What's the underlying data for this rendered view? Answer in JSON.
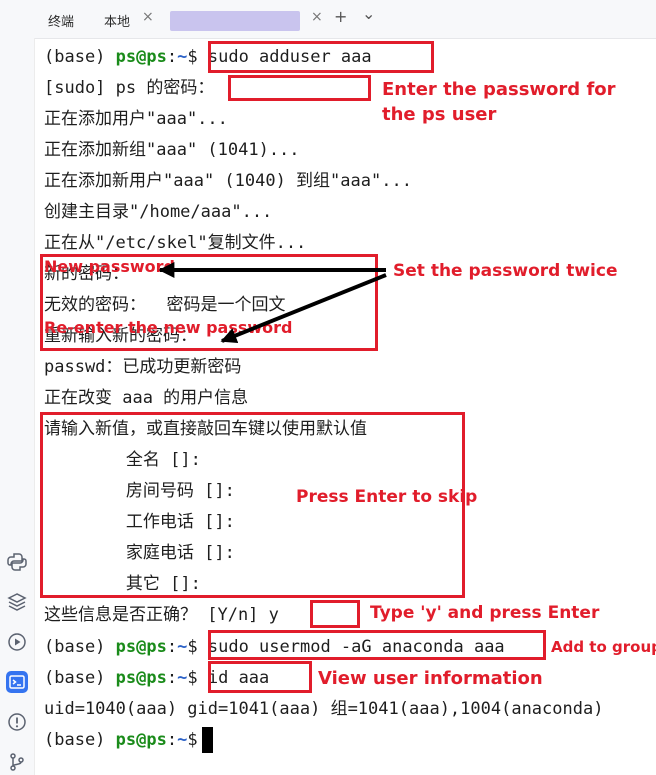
{
  "tabs": [
    {
      "label": "终端"
    },
    {
      "label": "本地",
      "close": "×"
    },
    {
      "label": "",
      "close": "×"
    }
  ],
  "tab_actions": {
    "add": "+",
    "dropdown": "⌄"
  },
  "prompt": {
    "env": "(base)",
    "user_host": "ps@ps",
    "sep": ":",
    "path": "~",
    "symbol": "$"
  },
  "terminal": {
    "cmd1": "sudo adduser aaa",
    "l2": "[sudo] ps 的密码：",
    "l3": "正在添加用户\"aaa\"...",
    "l4": "正在添加新组\"aaa\" (1041)...",
    "l5": "正在添加新用户\"aaa\" (1040) 到组\"aaa\"...",
    "l6": "创建主目录\"/home/aaa\"...",
    "l7": "正在从\"/etc/skel\"复制文件...",
    "l8": "新的密码：",
    "l9": "无效的密码：  密码是一个回文",
    "l10": "重新输入新的密码：",
    "l11": "passwd：已成功更新密码",
    "l12": "正在改变 aaa 的用户信息",
    "l13": "请输入新值，或直接敲回车键以使用默认值",
    "l14": "        全名 []:",
    "l15": "        房间号码 []:",
    "l16": "        工作电话 []:",
    "l17": "        家庭电话 []:",
    "l18": "        其它 []:",
    "l19": "这些信息是否正确？ [Y/n]",
    "l19_input": "y",
    "cmd2": "sudo usermod -aG anaconda aaa",
    "cmd3": "id aaa",
    "l22": "uid=1040(aaa) gid=1041(aaa) 组=1041(aaa),1004(anaconda)"
  },
  "annotations": {
    "enter_pw_line1": "Enter the password for",
    "enter_pw_line2": "the ps user",
    "new_password": "New password",
    "set_twice": "Set the password twice",
    "reenter": "Re-enter the new password",
    "press_enter": "Press Enter to skip",
    "type_y": "Type 'y' and press Enter",
    "add_group": "Add to group",
    "view_info": "View user information"
  },
  "colors": {
    "annotation": "#e11d2b",
    "prompt_user": "#1a8b1a",
    "prompt_path": "#2b61c7",
    "active_tool": "#3574f0"
  },
  "tool_icons": [
    "python-icon",
    "layers-icon",
    "run-icon",
    "terminal-icon",
    "problems-icon",
    "git-icon"
  ]
}
